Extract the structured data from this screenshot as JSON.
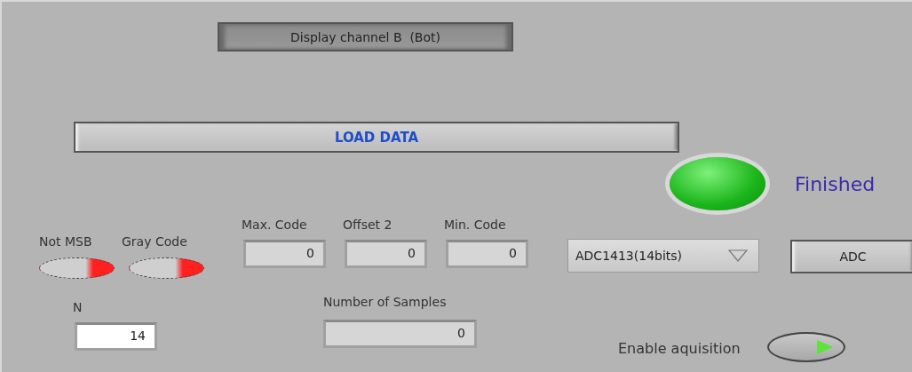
{
  "display_button": {
    "label": "Display channel B  (Bot)",
    "pressed": true
  },
  "load_button": {
    "label": "LOAD DATA"
  },
  "status": {
    "on": true,
    "label": "Finished"
  },
  "switches": [
    {
      "label": "Not MSB",
      "on": false
    },
    {
      "label": "Gray Code",
      "on": false
    }
  ],
  "fields": [
    {
      "label": "Max. Code",
      "value": "0"
    },
    {
      "label": "Offset 2",
      "value": "0"
    },
    {
      "label": "Min. Code",
      "value": "0"
    }
  ],
  "n_field": {
    "label": "N",
    "value": "14"
  },
  "samples_field": {
    "label": "Number of Samples",
    "value": "0"
  },
  "adc_select": {
    "value": "ADC1413(14bits)"
  },
  "adc_button": {
    "label": "ADC"
  },
  "enable": {
    "label": "Enable aquisition",
    "on": true
  }
}
